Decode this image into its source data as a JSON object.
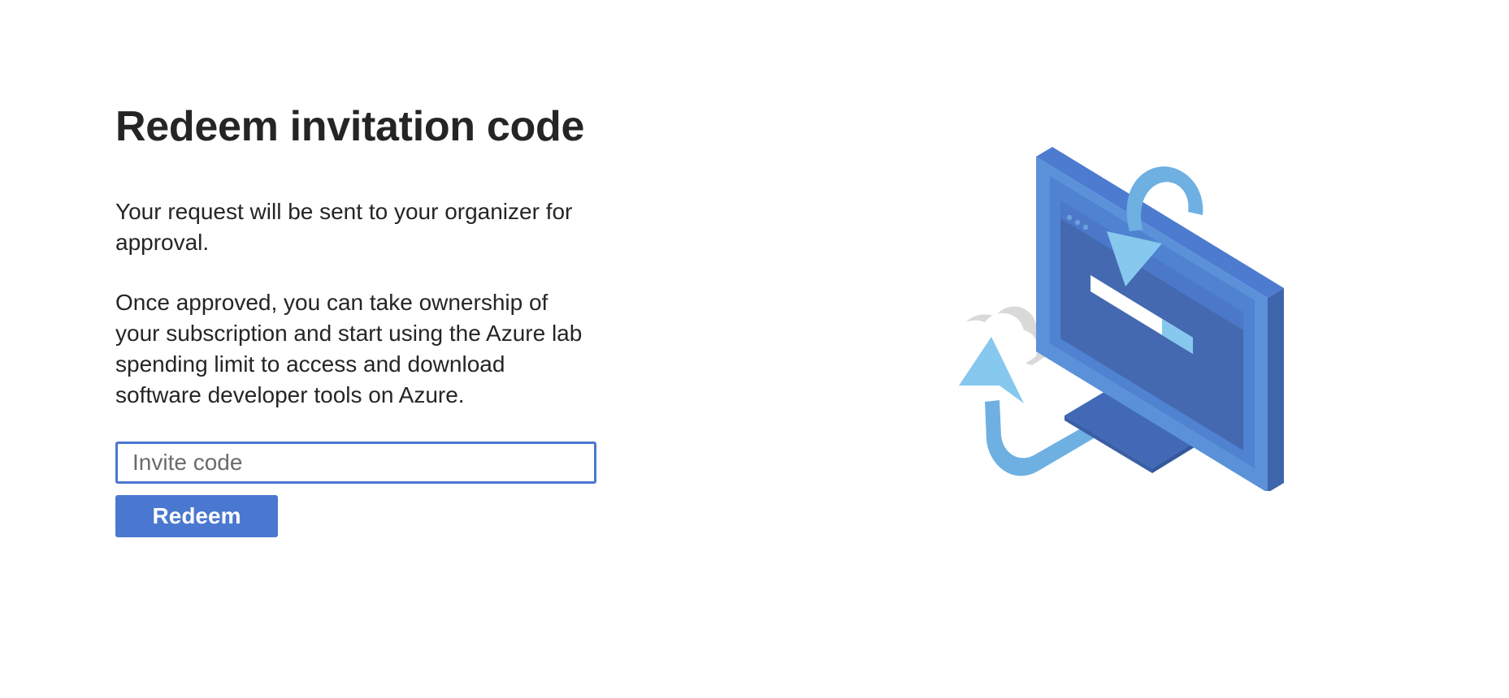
{
  "page": {
    "title": "Redeem invitation code",
    "paragraph_1": "Your request will be sent to your organizer for approval.",
    "paragraph_2": "Once approved, you can take ownership of your subscription and start using the Azure lab spending limit to access and download software developer tools on Azure."
  },
  "form": {
    "invite_code_value": "",
    "invite_code_placeholder": "Invite code",
    "redeem_label": "Redeem"
  },
  "illustration": {
    "icon": "monitor-cloud-sync-illustration"
  },
  "colors": {
    "accent": "#4a78d0",
    "monitor_dark": "#4168b0",
    "monitor_light": "#5b91d8",
    "arrow_light": "#7ec3ec",
    "cloud_gray": "#d8d8d8"
  }
}
